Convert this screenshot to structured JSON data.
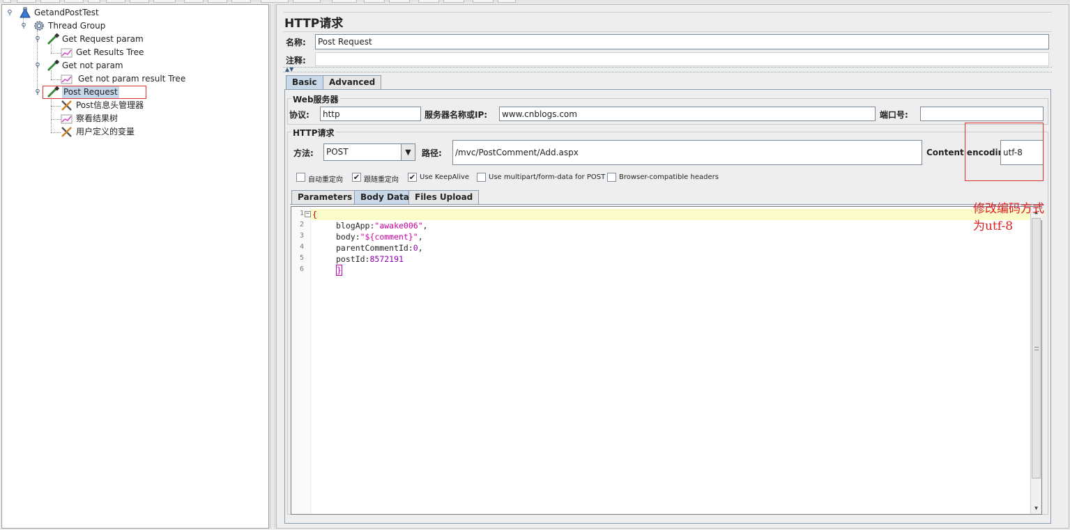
{
  "tree": {
    "items": [
      {
        "label": "GetandPostTest",
        "icon": "flask-icon"
      },
      {
        "label": "Thread Group",
        "icon": "gear-icon"
      },
      {
        "label": "Get Request param",
        "icon": "pipette-icon"
      },
      {
        "label": "Get Results Tree",
        "icon": "chart-icon"
      },
      {
        "label": "Get not param",
        "icon": "pipette-icon"
      },
      {
        "label": "Get not param result Tree",
        "icon": "chart-icon"
      },
      {
        "label": "Post Request",
        "icon": "pipette-icon"
      },
      {
        "label": "Post信息头管理器",
        "icon": "tools-icon"
      },
      {
        "label": "察看结果树",
        "icon": "chart-icon"
      },
      {
        "label": "用户定义的变量",
        "icon": "tools-icon"
      }
    ]
  },
  "panel": {
    "title": "HTTP请求",
    "name_label": "名称:",
    "name_value": "Post Request",
    "comment_label": "注释:",
    "comment_value": ""
  },
  "tabs": {
    "basic": "Basic",
    "advanced": "Advanced"
  },
  "web_server": {
    "group_title": "Web服务器",
    "protocol_label": "协议:",
    "protocol_value": "http",
    "server_label": "服务器名称或IP:",
    "server_value": "www.cnblogs.com",
    "port_label": "端口号:",
    "port_value": ""
  },
  "http_request": {
    "group_title": "HTTP请求",
    "method_label": "方法:",
    "method_value": "POST",
    "path_label": "路径:",
    "path_value": "/mvc/PostComment/Add.aspx",
    "encoding_label": "Content encoding:",
    "encoding_value": "utf-8"
  },
  "checkboxes": [
    {
      "label": "自动重定向",
      "checked": false
    },
    {
      "label": "跟随重定向",
      "checked": true
    },
    {
      "label": "Use KeepAlive",
      "checked": true
    },
    {
      "label": "Use multipart/form-data for POST",
      "checked": false
    },
    {
      "label": "Browser-compatible headers",
      "checked": false
    }
  ],
  "sub_tabs": {
    "parameters": "Parameters",
    "body_data": "Body Data",
    "files_upload": "Files Upload"
  },
  "editor": {
    "line_numbers": [
      "1",
      "2",
      "3",
      "4",
      "5",
      "6"
    ],
    "line1": "{",
    "key_blogapp": "blogApp:",
    "val_blogapp": "\"awake006\"",
    "key_body": "body:",
    "val_body": "\"${comment}\"",
    "key_parent": "parentCommentId:",
    "val_parent": "0",
    "key_postid": "postId:",
    "val_postid": "8572191",
    "line6": "}",
    "comma": ","
  },
  "annotation": {
    "line1": "修改编码方式",
    "line2": "为utf-8",
    "color": "#e02020"
  }
}
